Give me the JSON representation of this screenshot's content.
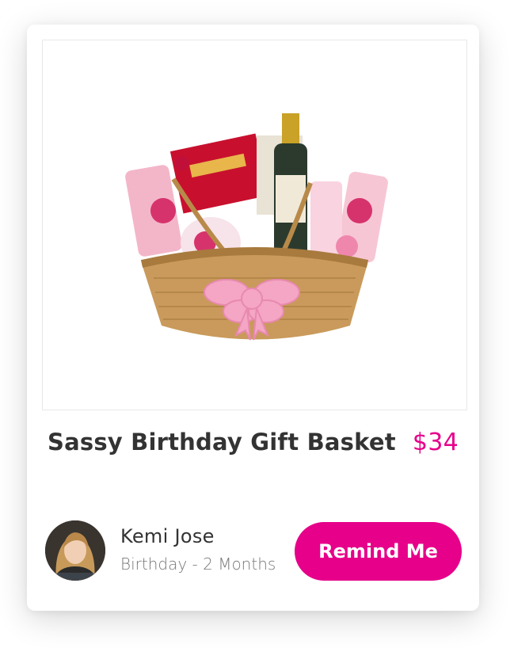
{
  "product": {
    "title": "Sassy Birthday Gift Basket",
    "price": "$34",
    "image_icon": "gift-basket-image"
  },
  "person": {
    "name": "Kemi Jose",
    "subtitle": "Birthday - 2 Months",
    "avatar_icon": "person-avatar"
  },
  "actions": {
    "remind_label": "Remind Me"
  },
  "colors": {
    "accent": "#e6008a",
    "text_primary": "#333333",
    "text_secondary": "#777777"
  }
}
